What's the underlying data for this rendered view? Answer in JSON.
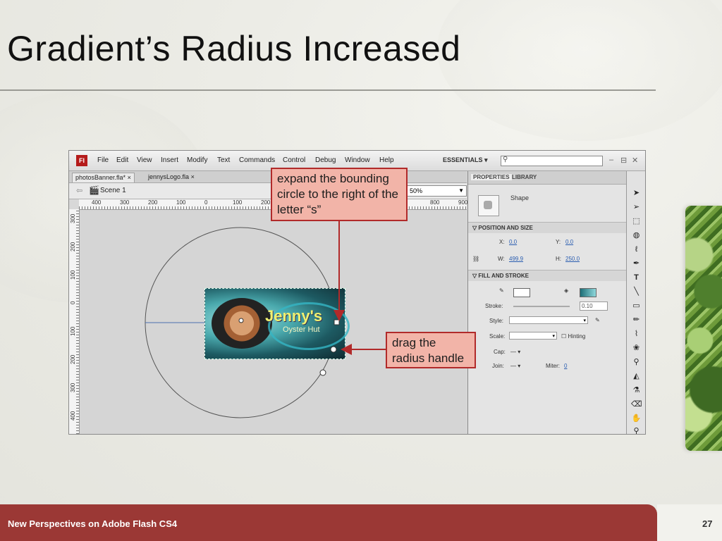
{
  "slide": {
    "title": "Gradient’s Radius Increased",
    "footer_text": "New Perspectives on Adobe Flash CS4",
    "page_number": "27"
  },
  "app": {
    "logo_text": "Fl",
    "menu": [
      "File",
      "Edit",
      "View",
      "Insert",
      "Modify",
      "Text",
      "Commands",
      "Control",
      "Debug",
      "Window",
      "Help"
    ],
    "workspace": "ESSENTIALS",
    "window_controls": [
      "–",
      "⊟",
      "✕"
    ],
    "doc_tabs": [
      {
        "label": "photosBanner.fla*",
        "close": "×"
      },
      {
        "label": "jennysLogo.fla",
        "close": "×"
      }
    ],
    "scene": "Scene 1",
    "zoom": "50%",
    "hruler_labels": [
      "400",
      "300",
      "200",
      "100",
      "0",
      "100",
      "200",
      "800",
      "900"
    ],
    "vruler_labels": [
      "300",
      "200",
      "100",
      "0",
      "100",
      "200",
      "300",
      "400"
    ]
  },
  "banner": {
    "title": "Jenny's",
    "subtitle": "Oyster Hut"
  },
  "properties": {
    "tabs": [
      "PROPERTIES",
      "LIBRARY"
    ],
    "object_type": "Shape",
    "position_section": "POSITION AND SIZE",
    "x_label": "X:",
    "x_value": "0.0",
    "y_label": "Y:",
    "y_value": "0.0",
    "w_label": "W:",
    "w_value": "499.9",
    "h_label": "H:",
    "h_value": "250.0",
    "fill_section": "FILL AND STROKE",
    "stroke_label": "Stroke:",
    "stroke_value": "0.10",
    "style_label": "Style:",
    "scale_label": "Scale:",
    "hinting_label": "Hinting",
    "cap_label": "Cap:",
    "cap_value": "—",
    "join_label": "Join:",
    "join_value": "—",
    "miter_label": "Miter:",
    "miter_value": "0"
  },
  "tools": [
    "arrow-tool",
    "subselect-tool",
    "free-transform-tool",
    "3d-rotation-tool",
    "lasso-tool",
    "pen-tool",
    "text-tool",
    "line-tool",
    "rectangle-tool",
    "pencil-tool",
    "brush-tool",
    "deco-tool",
    "bone-tool",
    "paint-bucket-tool",
    "eyedropper-tool",
    "eraser-tool",
    "hand-tool",
    "zoom-tool"
  ],
  "callouts": {
    "expand": "expand the bounding circle to the right of the letter “s”",
    "drag": "drag the radius handle"
  },
  "colors": {
    "footer": "#9b3835",
    "callout_fill": "#f2b4a8",
    "callout_border": "#b12a2a",
    "flash_red": "#b51b1b"
  }
}
